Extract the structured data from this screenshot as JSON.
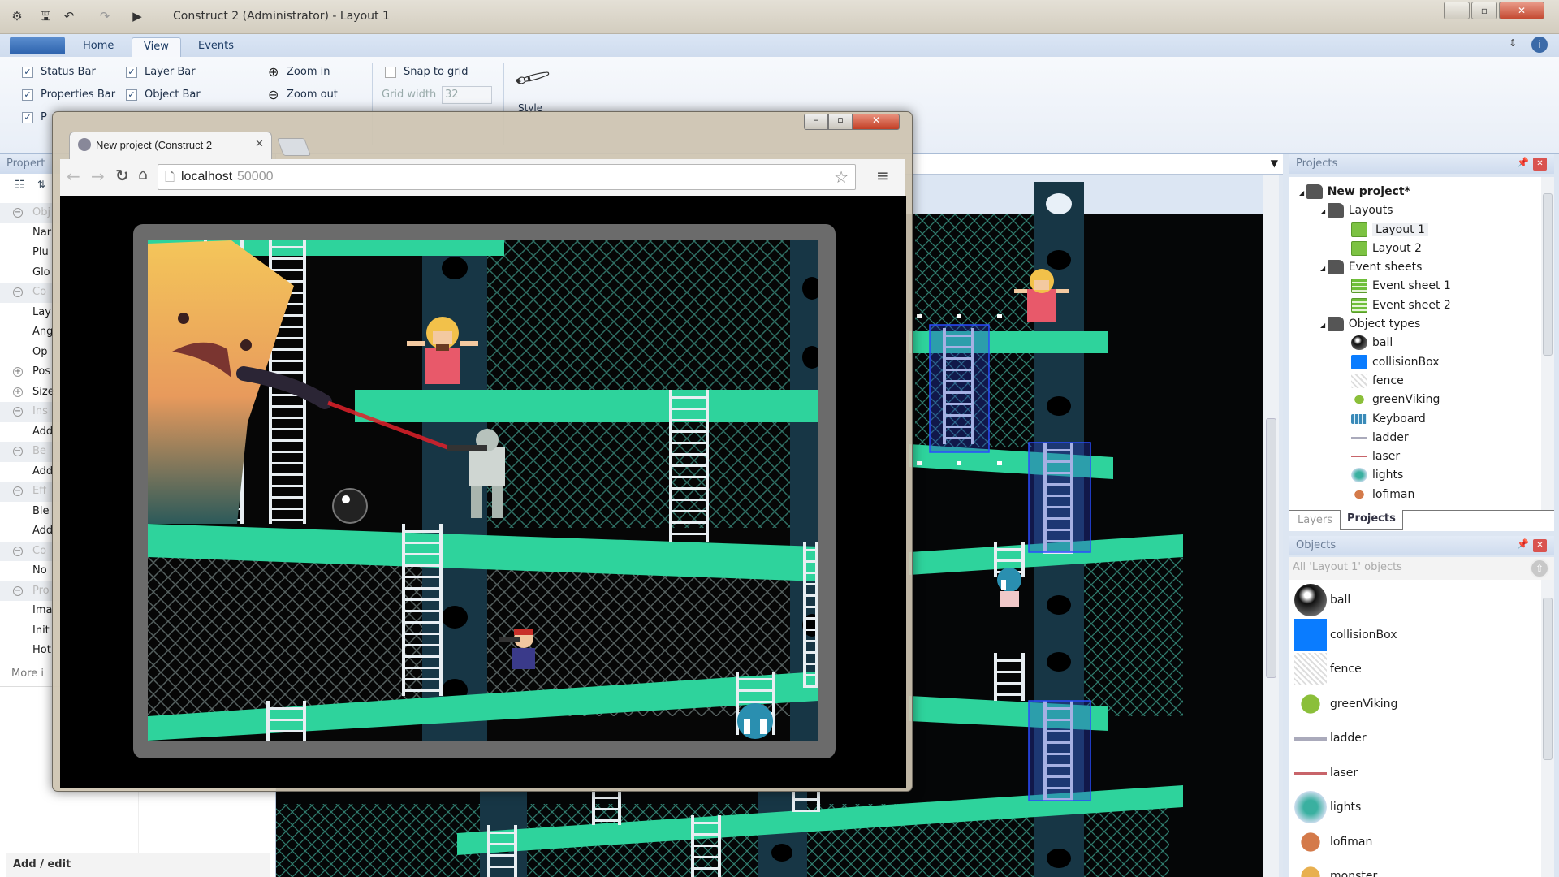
{
  "window": {
    "title": "Construct 2 (Administrator) - Layout 1"
  },
  "ribbon": {
    "tabs": [
      {
        "label": "Home"
      },
      {
        "label": "View"
      },
      {
        "label": "Events"
      }
    ],
    "active_tab": "View",
    "checks": [
      {
        "label": "Status Bar",
        "checked": true
      },
      {
        "label": "Layer Bar",
        "checked": true
      },
      {
        "label": "Properties Bar",
        "checked": true
      },
      {
        "label": "Object Bar",
        "checked": true
      },
      {
        "label": "P",
        "checked": true
      }
    ],
    "zoom_in": "Zoom in",
    "zoom_out": "Zoom out",
    "snap_to_grid": {
      "label": "Snap to grid",
      "checked": false
    },
    "grid_width": {
      "label": "Grid width",
      "value": "32"
    },
    "style": "Style"
  },
  "properties": {
    "title": "Propert",
    "rows": [
      {
        "t": "Obj",
        "h": true
      },
      {
        "t": "Nar"
      },
      {
        "t": "Plu"
      },
      {
        "t": "Glo"
      },
      {
        "t": "Co",
        "h": true
      },
      {
        "t": "Lay"
      },
      {
        "t": "Ang"
      },
      {
        "t": "Op"
      },
      {
        "t": "Pos",
        "plus": true
      },
      {
        "t": "Size",
        "plus": true
      },
      {
        "t": "Ins",
        "h": true
      },
      {
        "t": "Add"
      },
      {
        "t": "Be",
        "h": true
      },
      {
        "t": "Add"
      },
      {
        "t": "Eff",
        "h": true
      },
      {
        "t": "Ble"
      },
      {
        "t": "Add"
      },
      {
        "t": "Co",
        "h": true
      },
      {
        "t": "No"
      },
      {
        "t": "Pro",
        "h": true
      },
      {
        "t": "Ima"
      },
      {
        "t": "Init"
      },
      {
        "t": "Hot"
      }
    ],
    "more_info": "More i",
    "footer_title": "Add / edit"
  },
  "browser": {
    "tab_title": "New project (Construct 2",
    "url_host": "localhost",
    "url_port": "50000"
  },
  "projects": {
    "title": "Projects",
    "tree": [
      {
        "label": "New project*",
        "level": 0,
        "icon": "folder",
        "bold": true
      },
      {
        "label": "Layouts",
        "level": 1,
        "icon": "folder"
      },
      {
        "label": "Layout 1",
        "level": 2,
        "icon": "layout",
        "selected": true
      },
      {
        "label": "Layout 2",
        "level": 2,
        "icon": "layout"
      },
      {
        "label": "Event sheets",
        "level": 1,
        "icon": "folder"
      },
      {
        "label": "Event sheet 1",
        "level": 2,
        "icon": "event-sheet"
      },
      {
        "label": "Event sheet 2",
        "level": 2,
        "icon": "event-sheet"
      },
      {
        "label": "Object types",
        "level": 1,
        "icon": "folder"
      },
      {
        "label": "ball",
        "level": 2,
        "icon": "ball"
      },
      {
        "label": "collisionBox",
        "level": 2,
        "icon": "box"
      },
      {
        "label": "fence",
        "level": 2,
        "icon": "fence"
      },
      {
        "label": "greenViking",
        "level": 2,
        "icon": "viking"
      },
      {
        "label": "Keyboard",
        "level": 2,
        "icon": "keyboard"
      },
      {
        "label": "ladder",
        "level": 2,
        "icon": "ladder"
      },
      {
        "label": "laser",
        "level": 2,
        "icon": "laser"
      },
      {
        "label": "lights",
        "level": 2,
        "icon": "lights"
      },
      {
        "label": "lofiman",
        "level": 2,
        "icon": "lofiman"
      }
    ],
    "bottom_tabs": [
      {
        "label": "Layers"
      },
      {
        "label": "Projects",
        "active": true
      }
    ]
  },
  "objects": {
    "title": "Objects",
    "filter": "All 'Layout 1' objects",
    "items": [
      {
        "label": "ball",
        "icon": "ball"
      },
      {
        "label": "collisionBox",
        "icon": "box"
      },
      {
        "label": "fence",
        "icon": "fence"
      },
      {
        "label": "greenViking",
        "icon": "viking"
      },
      {
        "label": "ladder",
        "icon": "ladder"
      },
      {
        "label": "laser",
        "icon": "laser"
      },
      {
        "label": "lights",
        "icon": "lights"
      },
      {
        "label": "lofiman",
        "icon": "lofiman"
      },
      {
        "label": "monster",
        "icon": "monster"
      }
    ]
  },
  "colors": {
    "platform": "#2ed39c",
    "pillar": "#173645",
    "collision": "#0a7cff",
    "laser": "#e0202a",
    "ribbon_blue": "#2c62ad"
  }
}
